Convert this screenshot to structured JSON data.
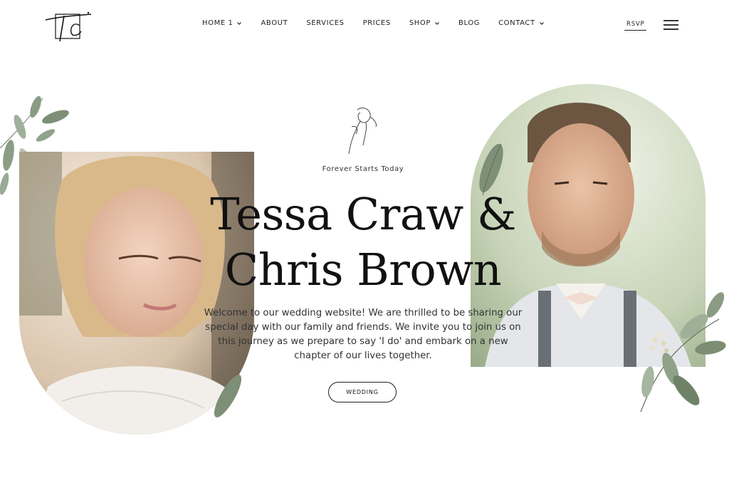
{
  "header": {
    "logo_alt": "TC",
    "nav": [
      {
        "label": "HOME 1",
        "has_dropdown": true
      },
      {
        "label": "ABOUT",
        "has_dropdown": false
      },
      {
        "label": "SERVICES",
        "has_dropdown": false
      },
      {
        "label": "PRICES",
        "has_dropdown": false
      },
      {
        "label": "SHOP",
        "has_dropdown": true
      },
      {
        "label": "BLOG",
        "has_dropdown": false
      },
      {
        "label": "CONTACT",
        "has_dropdown": true
      }
    ],
    "rsvp_label": "RSVP",
    "menu_icon": "hamburger-icon"
  },
  "hero": {
    "tagline": "Forever Starts Today",
    "names_line1": "Tessa Craw &",
    "names_line2": "Chris Brown",
    "welcome": "Welcome to our wedding website! We are thrilled to be sharing our special day with our family and friends. We invite you to join us on this journey as we prepare to say 'I do' and embark on a new chapter of our lives together.",
    "button_label": "WEDDING"
  },
  "colors": {
    "text": "#111111",
    "leaf": "#6f8a6a",
    "accent_dark": "#1e1e1e"
  }
}
